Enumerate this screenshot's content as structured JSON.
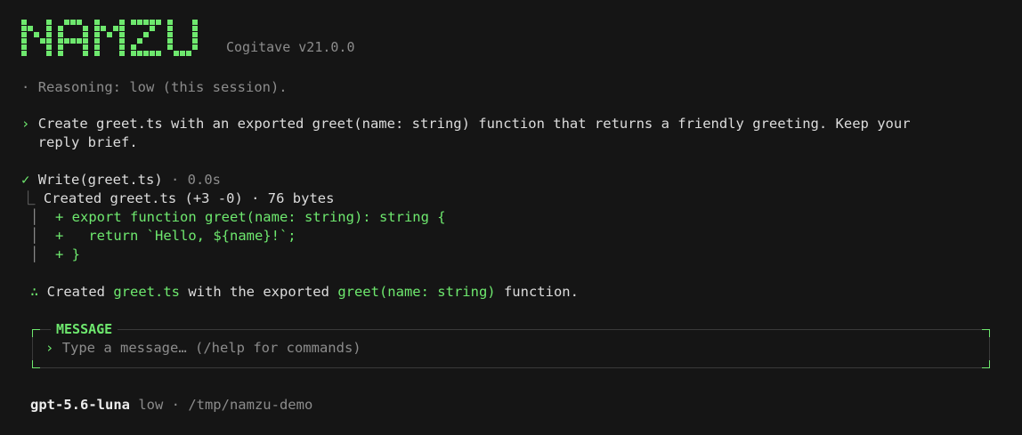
{
  "app": {
    "brand": "NAMZU",
    "version_text": "Cogitave v21.0.0"
  },
  "session": {
    "reasoning_bullet": "·",
    "reasoning_text": "Reasoning: low (this session)."
  },
  "user_prompt": {
    "mark": "›",
    "line1": "Create greet.ts with an exported greet(name: string) function that returns a friendly greeting. Keep your",
    "line2": "reply brief."
  },
  "tool_call": {
    "check": "✓",
    "name": "Write(greet.ts)",
    "duration": " · 0.0s",
    "result_prefix": "⎿ ",
    "result_text": "Created greet.ts (+3 -0) · 76 bytes",
    "diff": [
      {
        "gutter": "│",
        "line": "+ export function greet(name: string): string {"
      },
      {
        "gutter": "│",
        "line": "+   return `Hello, ${name}!`;"
      },
      {
        "gutter": "│",
        "line": "+ }"
      }
    ]
  },
  "summary": {
    "mark": "∴",
    "p1": " Created ",
    "code1": "greet.ts",
    "p2": " with the exported ",
    "code2": "greet(name: string)",
    "p3": " function."
  },
  "message_box": {
    "label": "MESSAGE",
    "prompt_mark": "›",
    "placeholder": "Type a message… (/help for commands)"
  },
  "status_bar": {
    "model": "gpt-5.6-luna",
    "effort": " low",
    "sep": " · ",
    "cwd": "/tmp/namzu-demo"
  },
  "colors": {
    "background": "#151515",
    "accent": "#6ee86e",
    "text": "#dcdcdc",
    "dim": "#8c8c8c"
  }
}
